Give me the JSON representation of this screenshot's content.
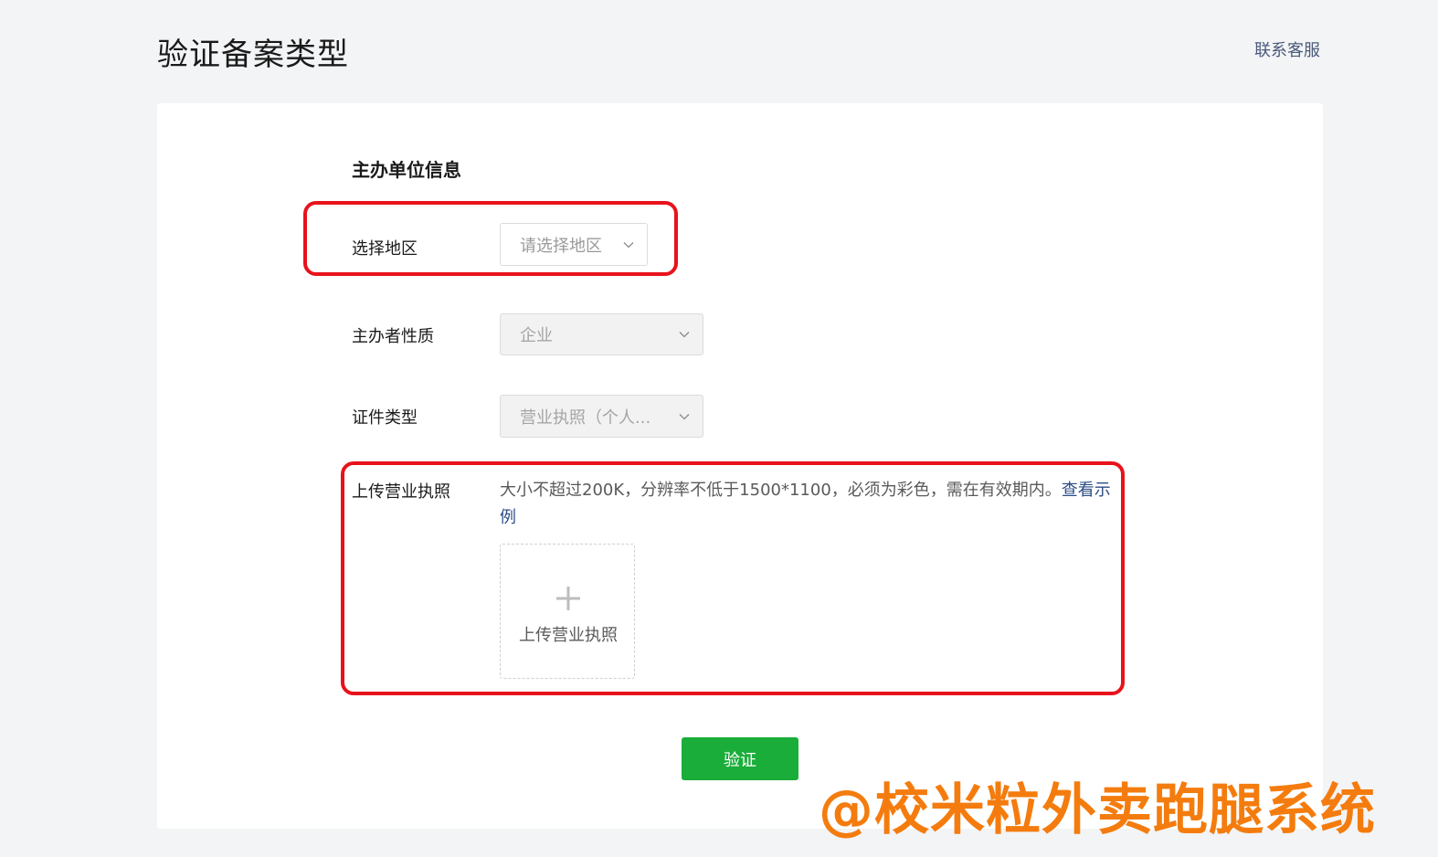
{
  "header": {
    "title": "验证备案类型",
    "contact_link": "联系客服"
  },
  "form": {
    "section_title": "主办单位信息",
    "region": {
      "label": "选择地区",
      "placeholder": "请选择地区",
      "icon": "chevron-down-icon"
    },
    "organizer_type": {
      "label": "主办者性质",
      "value": "企业",
      "icon": "chevron-down-icon"
    },
    "certificate_type": {
      "label": "证件类型",
      "value": "营业执照（个人...",
      "icon": "chevron-down-icon"
    },
    "upload": {
      "label": "上传营业执照",
      "hint": "大小不超过200K，分辨率不低于1500*1100，必须为彩色，需在有效期内。",
      "example_link": "查看示例",
      "box_label": "上传营业执照",
      "icon": "plus-icon"
    },
    "submit_label": "验证"
  },
  "watermark": "@校米粒外卖跑腿系统",
  "colors": {
    "primary_button": "#1aad3a",
    "highlight_border": "#e8121b",
    "link": "#2c4d86",
    "watermark": "#f47c0e"
  }
}
